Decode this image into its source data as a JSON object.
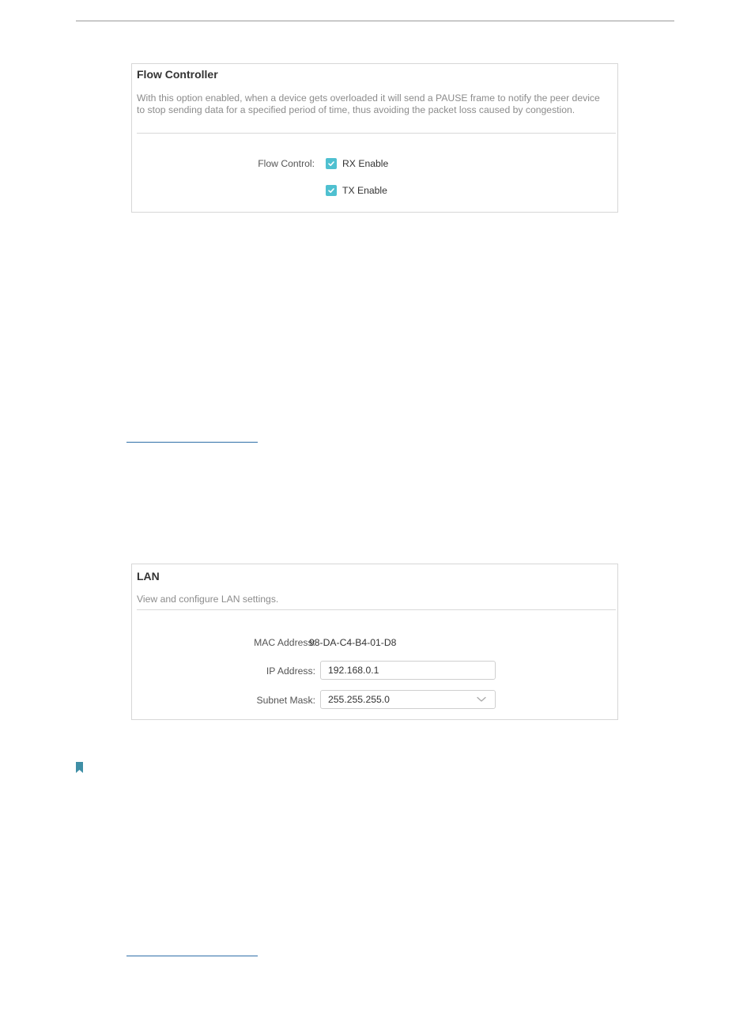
{
  "flow_controller": {
    "title": "Flow Controller",
    "description": "With this option enabled, when a device gets overloaded it will send a PAUSE frame to notify the peer device to stop sending data for a specified period of time, thus avoiding the packet loss caused by congestion.",
    "flow_control_label": "Flow Control:",
    "options": [
      {
        "label": "RX Enable",
        "checked": true
      },
      {
        "label": "TX Enable",
        "checked": true
      }
    ]
  },
  "lan": {
    "title": "LAN",
    "description": "View and configure LAN settings.",
    "mac_label": "MAC Address:",
    "mac_value": "98-DA-C4-B4-01-D8",
    "ip_label": "IP Address:",
    "ip_value": "192.168.0.1",
    "subnet_label": "Subnet Mask:",
    "subnet_value": "255.255.255.0"
  },
  "colors": {
    "accent": "#4fc0d0",
    "panel_border": "#d7d7d7",
    "muted_text": "#8c8c8c",
    "link": "#2f6fa8",
    "bookmark": "#3f8fa6"
  },
  "icons": {
    "checkbox": "checkmark-icon",
    "dropdown": "chevron-down-icon",
    "note": "bookmark-icon"
  }
}
